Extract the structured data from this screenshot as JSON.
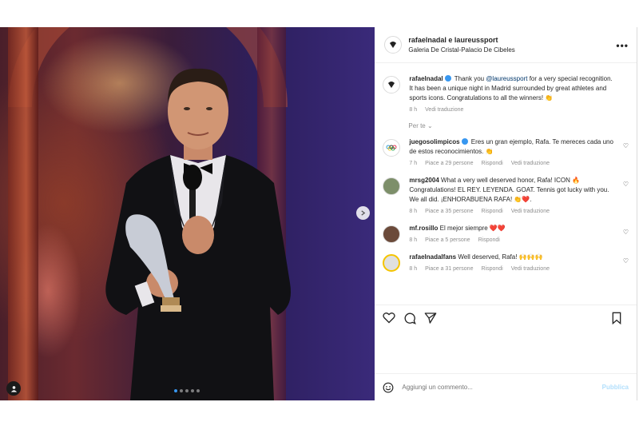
{
  "post": {
    "header": {
      "users": "rafaelnadal e laureussport",
      "location": "Galeria De Cristal-Palacio De Cibeles",
      "more_icon": "more-horizontal-icon"
    },
    "caption": {
      "user": "rafaelnadal",
      "text_before": "Thank you ",
      "mention": "@laureussport",
      "text_after": " for a very special recognition. It has been a unique night in Madrid surrounded by great athletes and sports icons. Congratulations to all the winners! 👏",
      "time": "8 h",
      "translate": "Vedi traduzione"
    },
    "for_you": "Per te ⌄",
    "comments": [
      {
        "user": "juegosolimpicos",
        "verified": true,
        "text": "Eres un gran ejemplo, Rafa. Te mereces cada uno de estos reconocimientos. 👏",
        "time": "7 h",
        "likes": "Piace a 29 persone",
        "reply": "Rispondi",
        "translate": "Vedi traduzione"
      },
      {
        "user": "mrsg2004",
        "verified": false,
        "text": "What a very well deserved honor, Rafa! ICON 🔥 Congratulations! EL REY. LEYENDA. GOAT. Tennis got lucky with you. We all did. ¡ENHORABUENA RAFA! 👏❤️.",
        "time": "8 h",
        "likes": "Piace a 35 persone",
        "reply": "Rispondi",
        "translate": "Vedi traduzione"
      },
      {
        "user": "mf.rosillo",
        "verified": false,
        "text": "El mejor siempre ❤️❤️",
        "time": "8 h",
        "likes": "Piace a 5 persone",
        "reply": "Rispondi",
        "translate": ""
      },
      {
        "user": "rafaelnadalfans",
        "verified": false,
        "text": "Well deserved, Rafa! 🙌🙌🙌",
        "time": "8 h",
        "likes": "Piace a 31 persone",
        "reply": "Rispondi",
        "translate": "Vedi traduzione"
      }
    ],
    "add_comment": {
      "placeholder": "Aggiungi un commento...",
      "publish": "Pubblica"
    },
    "colors": {
      "accent": "#3897f0",
      "link": "#00376b",
      "muted": "#8e8e8e"
    }
  }
}
